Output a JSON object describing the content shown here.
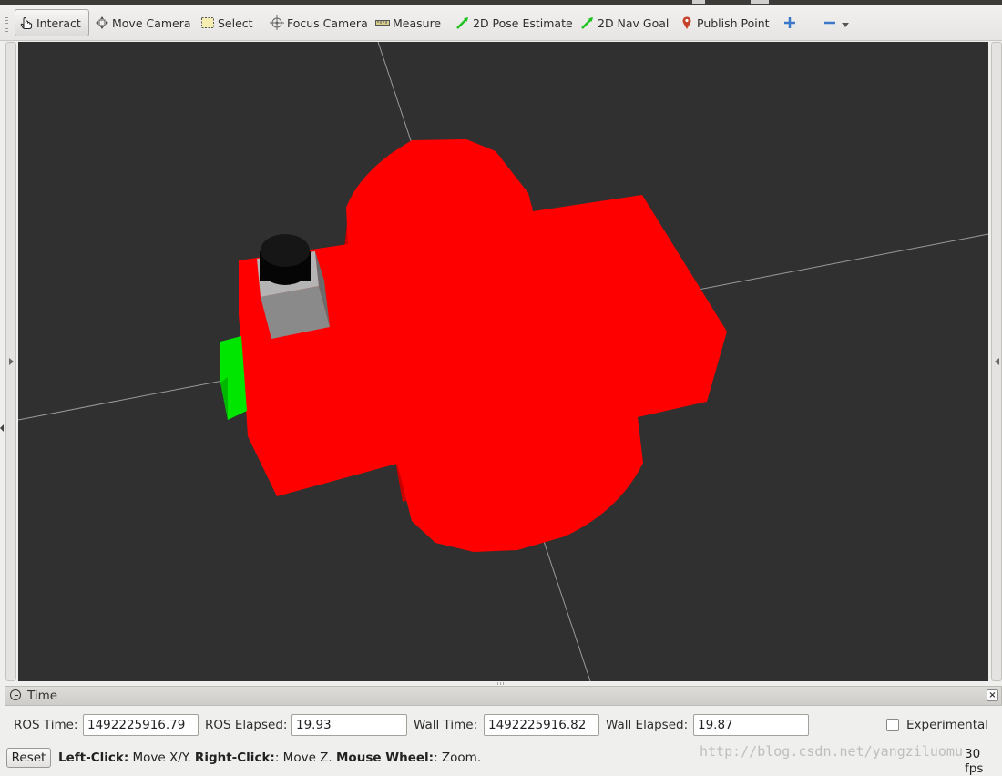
{
  "toolbar": {
    "tools": [
      {
        "label": "Interact",
        "icon": "hand-pointer-icon"
      },
      {
        "label": "Move Camera",
        "icon": "move-camera-icon"
      },
      {
        "label": "Select",
        "icon": "select-box-icon"
      },
      {
        "label": "Focus Camera",
        "icon": "focus-camera-icon"
      },
      {
        "label": "Measure",
        "icon": "ruler-icon"
      },
      {
        "label": "2D Pose Estimate",
        "icon": "green-arrow-icon"
      },
      {
        "label": "2D Nav Goal",
        "icon": "green-arrow-icon"
      },
      {
        "label": "Publish Point",
        "icon": "map-pin-icon"
      }
    ],
    "add_icon": "plus-icon",
    "remove_icon": "minus-icon",
    "active_tool": "Interact"
  },
  "viewport": {
    "background": "#303030",
    "robot_body_color": "#ff0000",
    "robot_edge_color": "#d10000",
    "caster_color": "#00ff00",
    "sensor_box_color": "#808080",
    "sensor_cap_color": "#000000"
  },
  "time_panel": {
    "title": "Time",
    "ros_time_label": "ROS Time:",
    "ros_time_value": "1492225916.79",
    "ros_elapsed_label": "ROS Elapsed:",
    "ros_elapsed_value": "19.93",
    "wall_time_label": "Wall Time:",
    "wall_time_value": "1492225916.82",
    "wall_elapsed_label": "Wall Elapsed:",
    "wall_elapsed_value": "19.87",
    "experimental_label": "Experimental"
  },
  "statusbar": {
    "reset_label": "Reset",
    "hint_left_click": "Left-Click:",
    "hint_left_action": " Move X/Y. ",
    "hint_right_click": "Right-Click:",
    "hint_right_action": ": Move Z. ",
    "hint_wheel": "Mouse Wheel:",
    "hint_wheel_action": ": Zoom.",
    "fps": "30 fps"
  },
  "watermark": "http://blog.csdn.net/yangziluomu"
}
